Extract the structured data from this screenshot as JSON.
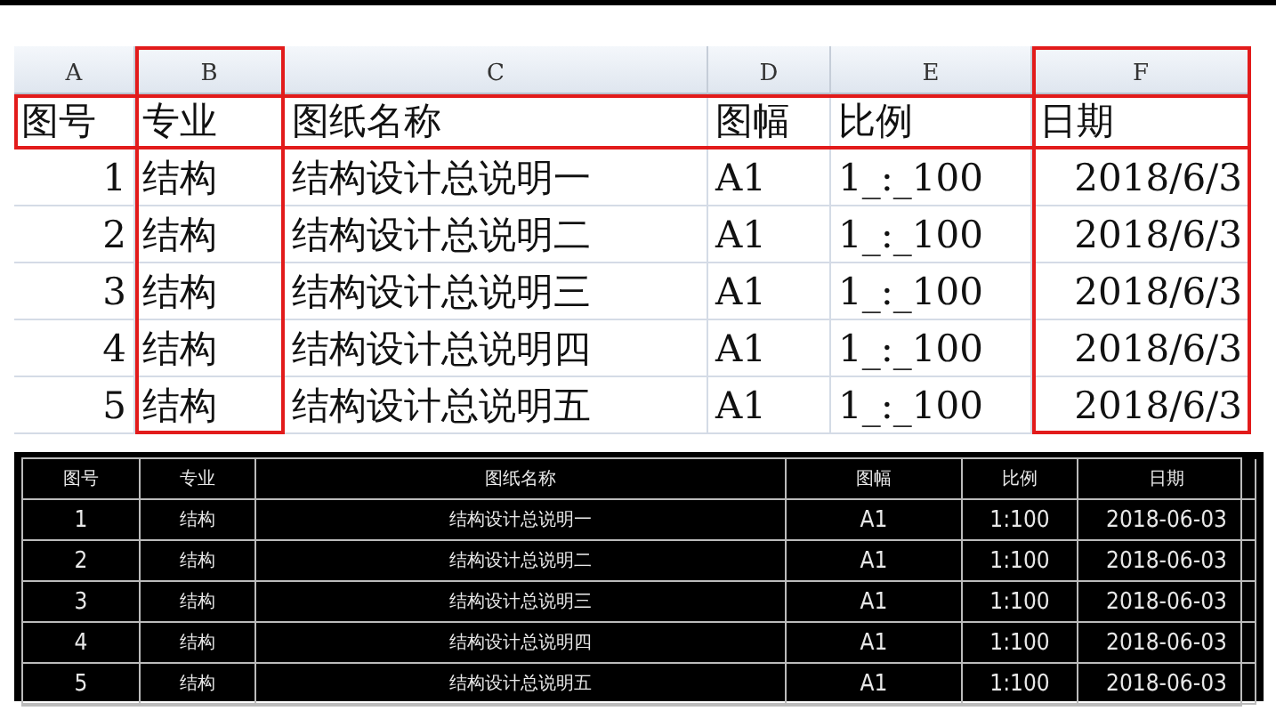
{
  "spreadsheet": {
    "column_letters": [
      {
        "letter": "A",
        "highlighted": false
      },
      {
        "letter": "B",
        "highlighted": true
      },
      {
        "letter": "C",
        "highlighted": false
      },
      {
        "letter": "D",
        "highlighted": false
      },
      {
        "letter": "E",
        "highlighted": false
      },
      {
        "letter": "F",
        "highlighted": true
      }
    ],
    "header": {
      "highlighted": true,
      "cells": [
        "图号",
        "专业",
        "图纸名称",
        "图幅",
        "比例",
        "日期"
      ]
    },
    "rows": [
      [
        "1",
        "结构",
        "结构设计总说明一",
        "A1",
        "1_:_100",
        "2018/6/3"
      ],
      [
        "2",
        "结构",
        "结构设计总说明二",
        "A1",
        "1_:_100",
        "2018/6/3"
      ],
      [
        "3",
        "结构",
        "结构设计总说明三",
        "A1",
        "1_:_100",
        "2018/6/3"
      ],
      [
        "4",
        "结构",
        "结构设计总说明四",
        "A1",
        "1_:_100",
        "2018/6/3"
      ],
      [
        "5",
        "结构",
        "结构设计总说明五",
        "A1",
        "1_:_100",
        "2018/6/3"
      ]
    ]
  },
  "cad_table": {
    "header": [
      "图号",
      "专业",
      "图纸名称",
      "图幅",
      "比例",
      "日期"
    ],
    "rows": [
      [
        "1",
        "结构",
        "结构设计总说明一",
        "A1",
        "1:100",
        "2018-06-03"
      ],
      [
        "2",
        "结构",
        "结构设计总说明二",
        "A1",
        "1:100",
        "2018-06-03"
      ],
      [
        "3",
        "结构",
        "结构设计总说明三",
        "A1",
        "1:100",
        "2018-06-03"
      ],
      [
        "4",
        "结构",
        "结构设计总说明四",
        "A1",
        "1:100",
        "2018-06-03"
      ],
      [
        "5",
        "结构",
        "结构设计总说明五",
        "A1",
        "1:100",
        "2018-06-03"
      ]
    ]
  }
}
